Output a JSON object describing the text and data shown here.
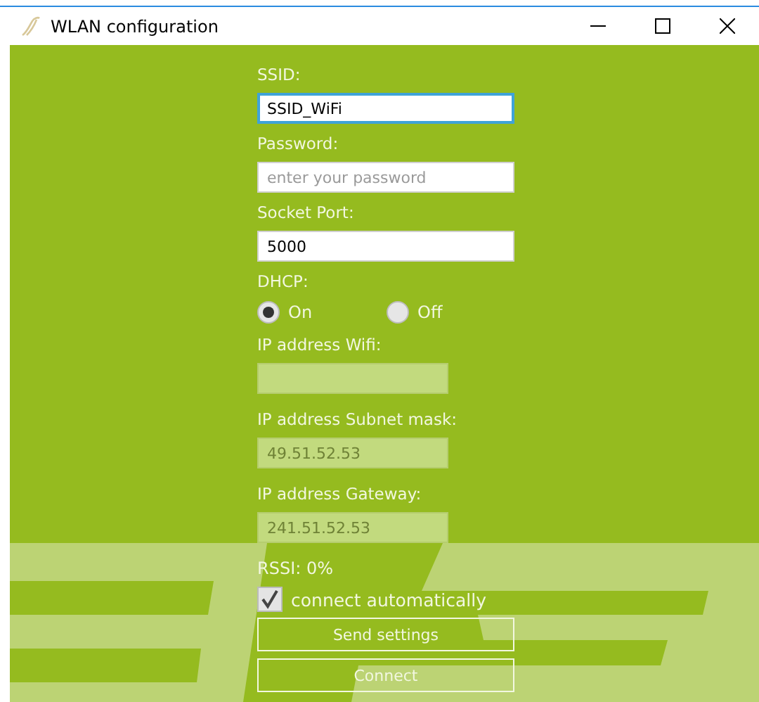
{
  "window": {
    "title": "WLAN configuration"
  },
  "fields": [
    {
      "kind": "text",
      "label": "SSID:",
      "value": "SSID_WiFi",
      "focused": true,
      "disabled": false
    },
    {
      "kind": "text",
      "label": "Password:",
      "placeholder": "enter your password",
      "focused": false,
      "disabled": false
    },
    {
      "kind": "text",
      "label": "Socket Port:",
      "value": "5000",
      "focused": false,
      "disabled": false
    },
    {
      "kind": "radio",
      "label": "DHCP:",
      "options": [
        {
          "label": "On",
          "selected": true
        },
        {
          "label": "Off",
          "selected": false
        }
      ]
    },
    {
      "kind": "ip",
      "label": "IP address Wifi:",
      "focused": false,
      "disabled": true
    },
    {
      "kind": "ip",
      "label": "IP address Subnet mask:",
      "value": "49.51.52.53",
      "focused": false,
      "disabled": true
    },
    {
      "kind": "ip",
      "label": "IP address Gateway:",
      "value": "241.51.52.53",
      "focused": false,
      "disabled": true
    }
  ],
  "rssi": "RSSI: 0%",
  "auto_connect": {
    "label": "connect automatically",
    "checked": true
  },
  "buttons": [
    "Send settings",
    "Connect"
  ]
}
